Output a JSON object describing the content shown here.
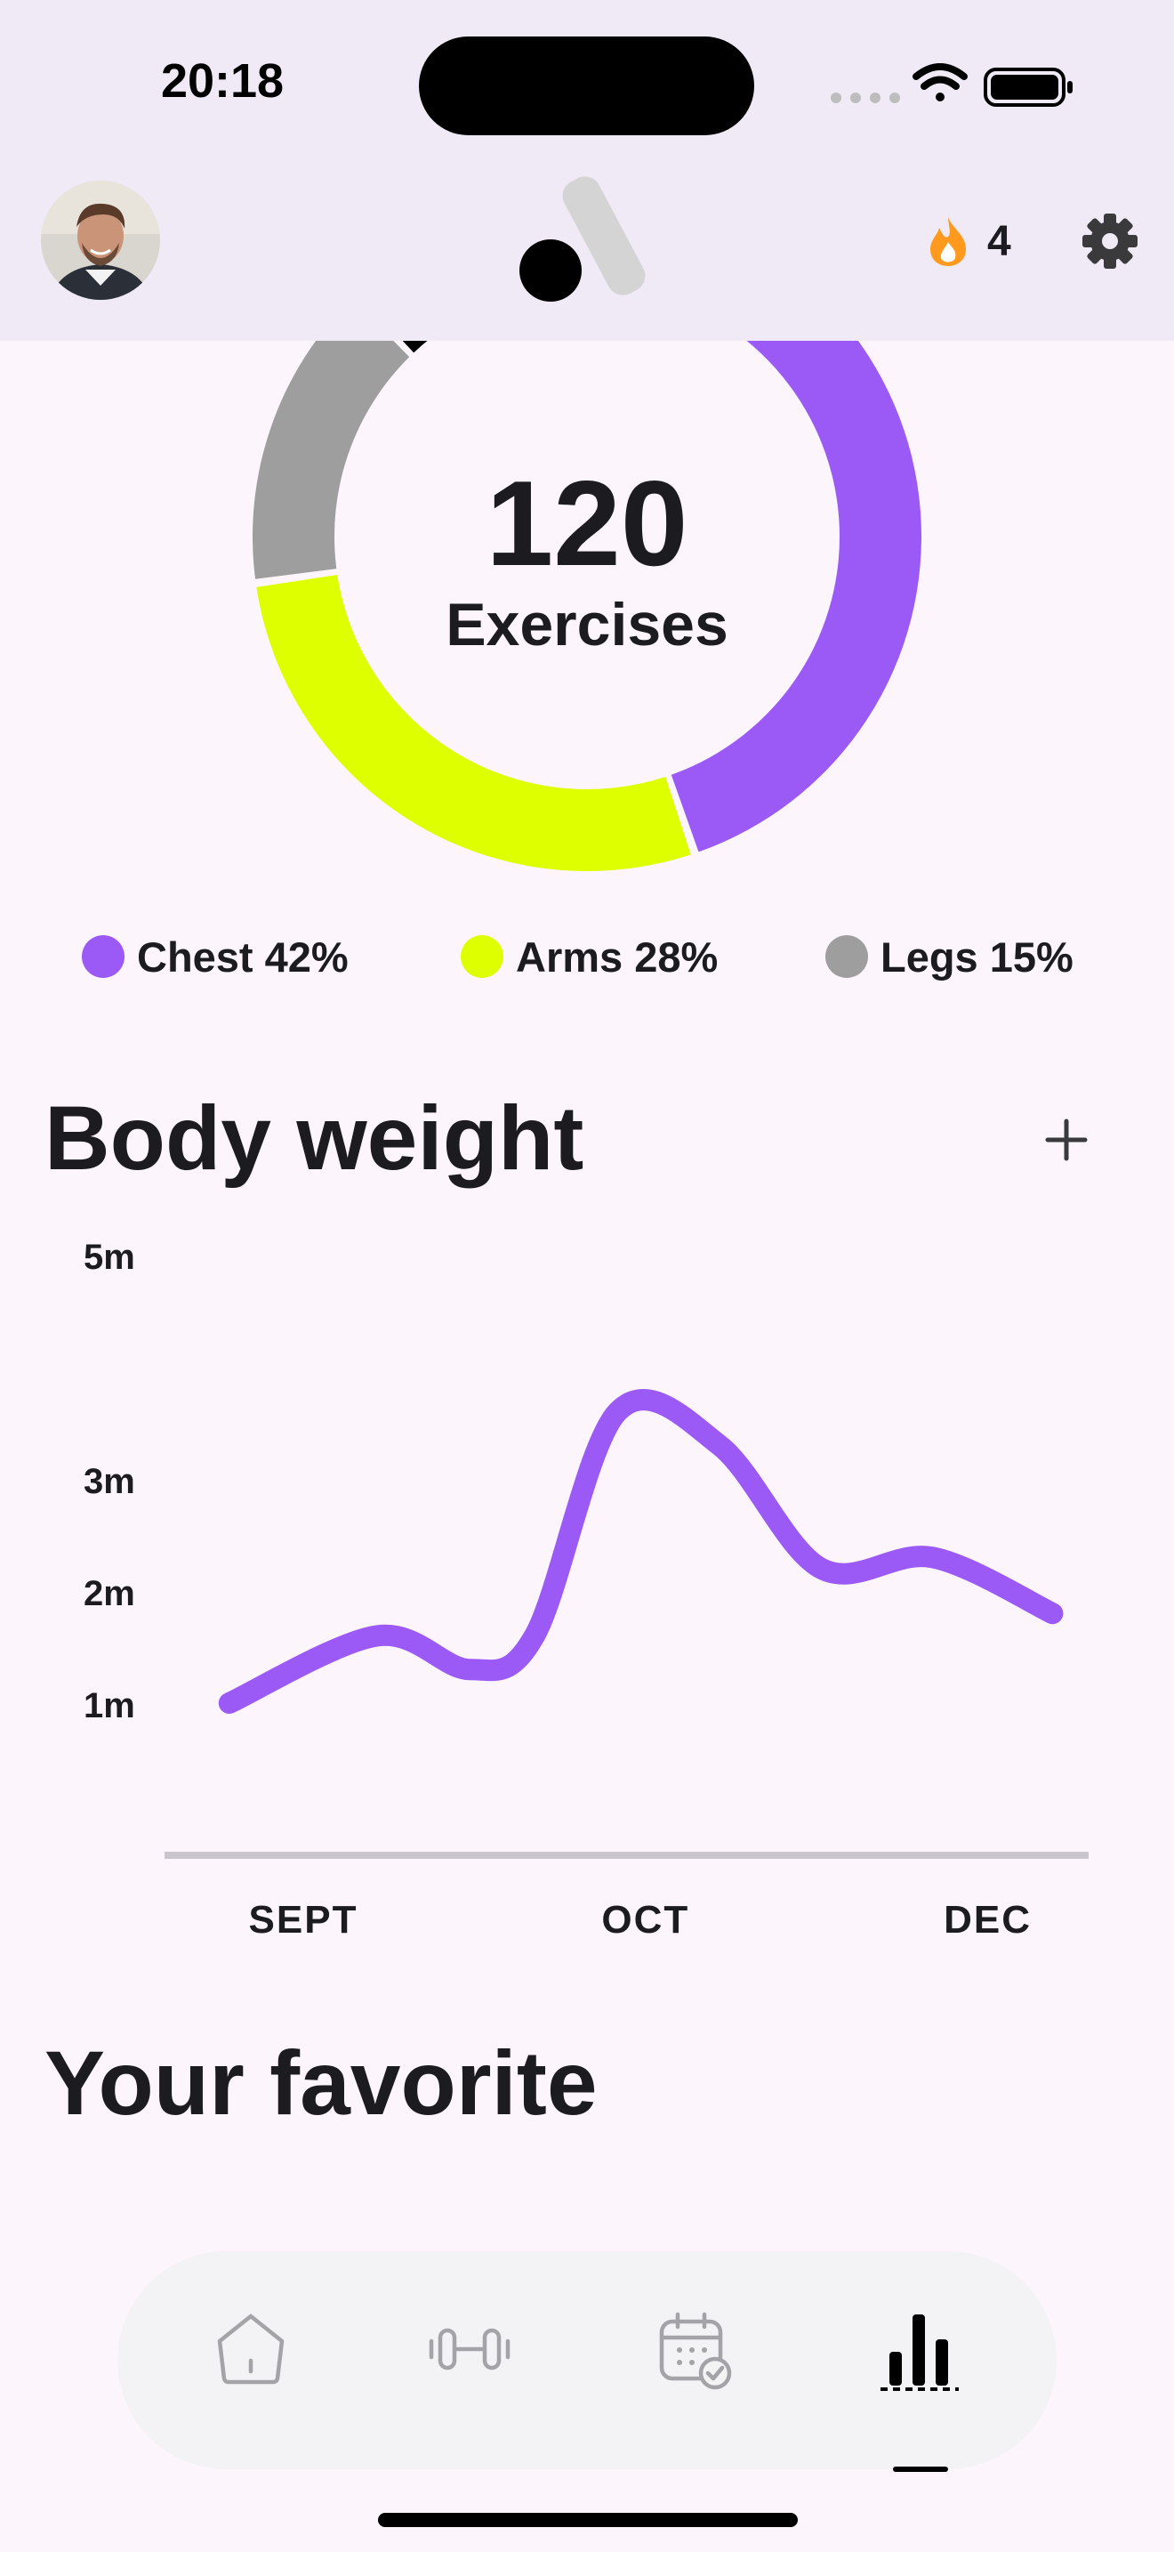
{
  "status_bar": {
    "time": "20:18"
  },
  "header": {
    "avatar_icon": "user-avatar",
    "logo_icon": "app-logo",
    "streak_icon": "fire-icon",
    "streak_count": "4",
    "settings_icon": "gear-icon"
  },
  "summary": {
    "total_value": "120",
    "total_label": "Exercises",
    "legend": [
      {
        "label": "Chest 42%",
        "color": "#9b59f5"
      },
      {
        "label": "Arms 28%",
        "color": "#ddff00"
      },
      {
        "label": "Legs 15%",
        "color": "#9e9e9e"
      }
    ]
  },
  "body_weight": {
    "title": "Body weight",
    "add_icon": "plus-icon"
  },
  "favorite": {
    "title": "Your favorite"
  },
  "bottom_nav": {
    "tabs": [
      {
        "icon": "home-icon",
        "active": false
      },
      {
        "icon": "dumbbell-icon",
        "active": false
      },
      {
        "icon": "calendar-check-icon",
        "active": false
      },
      {
        "icon": "stats-icon",
        "active": true
      }
    ]
  },
  "colors": {
    "accent": "#9b59f5",
    "lime": "#ddff00",
    "gray": "#9e9e9e",
    "header_bg": "#f0eaf6",
    "page_bg": "#fcf5fc"
  },
  "chart_data": [
    {
      "type": "pie",
      "style": "donut",
      "center_value": "120",
      "center_label": "Exercises",
      "slices": [
        {
          "label": "Chest",
          "percent": 42,
          "color": "#9b59f5"
        },
        {
          "label": "Arms",
          "percent": 28,
          "color": "#ddff00"
        },
        {
          "label": "Legs",
          "percent": 15,
          "color": "#9e9e9e"
        },
        {
          "label": "",
          "percent": 15,
          "color": "#000000"
        }
      ],
      "legend_position": "bottom"
    },
    {
      "type": "line",
      "title": "Body weight",
      "y_ticks": [
        "5m",
        "3m",
        "2m",
        "1m"
      ],
      "y_tick_values": [
        5,
        3,
        2,
        1
      ],
      "x_ticks": [
        "SEPT",
        "OCT",
        "DEC"
      ],
      "x_tick_values": [
        0.15,
        0.52,
        0.89
      ],
      "ylim": [
        0,
        5
      ],
      "xlim": [
        0,
        1
      ],
      "grid": false,
      "series": [
        {
          "color": "#9b59f5",
          "points": [
            [
              0.07,
              1.0
            ],
            [
              0.23,
              1.6
            ],
            [
              0.33,
              1.3
            ],
            [
              0.4,
              1.6
            ],
            [
              0.49,
              3.6
            ],
            [
              0.6,
              3.3
            ],
            [
              0.71,
              2.2
            ],
            [
              0.83,
              2.3
            ],
            [
              0.96,
              1.8
            ]
          ]
        }
      ]
    }
  ]
}
